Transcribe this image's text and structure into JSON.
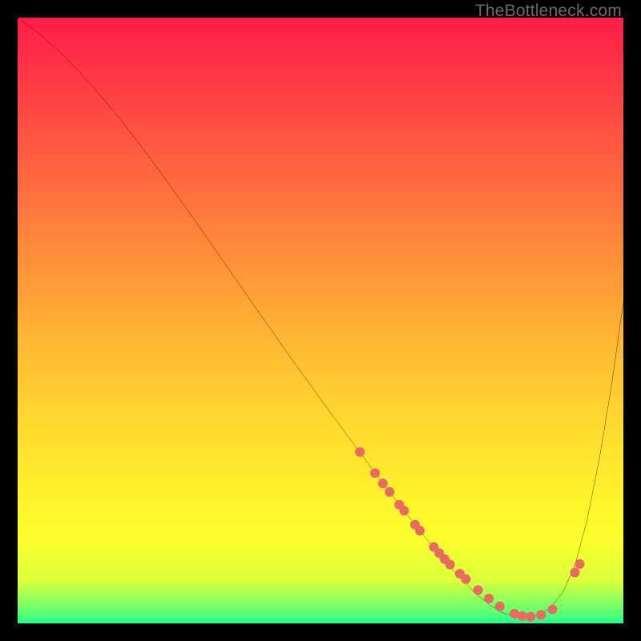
{
  "attribution": "TheBottleneck.com",
  "colors": {
    "background": "#000000",
    "curve": "#000000",
    "dots": "#e86a62",
    "gradient_top": "#ff1c49",
    "gradient_bottom": "#22ff8a"
  },
  "chart_data": {
    "type": "line",
    "title": "",
    "xlabel": "",
    "ylabel": "",
    "xlim": [
      0,
      100
    ],
    "ylim": [
      0,
      100
    ],
    "grid": false,
    "legend": false,
    "background_gradient": "red→yellow→green (top→bottom)",
    "annotations": [],
    "series": [
      {
        "name": "bottleneck-curve",
        "x": [
          0,
          4,
          8,
          12,
          16,
          20,
          24,
          28,
          32,
          36,
          40,
          44,
          48,
          52,
          56,
          58,
          60,
          62,
          64,
          66,
          68,
          70,
          72,
          74,
          76,
          78,
          80,
          82,
          84,
          86,
          88,
          90,
          92,
          94,
          96,
          98,
          100
        ],
        "y": [
          100,
          97,
          93.3,
          89.1,
          84.4,
          79.3,
          73.9,
          68.3,
          62.6,
          56.8,
          51.1,
          45.4,
          39.8,
          34.3,
          28.9,
          26.2,
          23.5,
          20.9,
          18.3,
          15.8,
          13.3,
          10.9,
          8.6,
          6.5,
          4.6,
          3.0,
          1.8,
          1.1,
          0.9,
          1.3,
          2.6,
          5.1,
          9.6,
          17.0,
          27.0,
          39.0,
          53.0
        ]
      }
    ],
    "scatter_overlay": {
      "name": "highlight-dots",
      "x": [
        56.5,
        59.0,
        60.3,
        61.4,
        63.0,
        63.8,
        65.6,
        66.4,
        68.7,
        69.6,
        70.5,
        71.4,
        73.0,
        74.0,
        76.0,
        77.8,
        79.6,
        82.0,
        83.3,
        84.7,
        86.4,
        88.3,
        92.0,
        92.8
      ],
      "y": [
        28.3,
        24.8,
        23.1,
        21.7,
        19.6,
        18.6,
        16.3,
        15.3,
        12.6,
        11.6,
        10.6,
        9.7,
        8.2,
        7.3,
        5.5,
        4.1,
        2.8,
        1.6,
        1.2,
        1.1,
        1.4,
        2.3,
        8.4,
        9.8
      ]
    }
  }
}
